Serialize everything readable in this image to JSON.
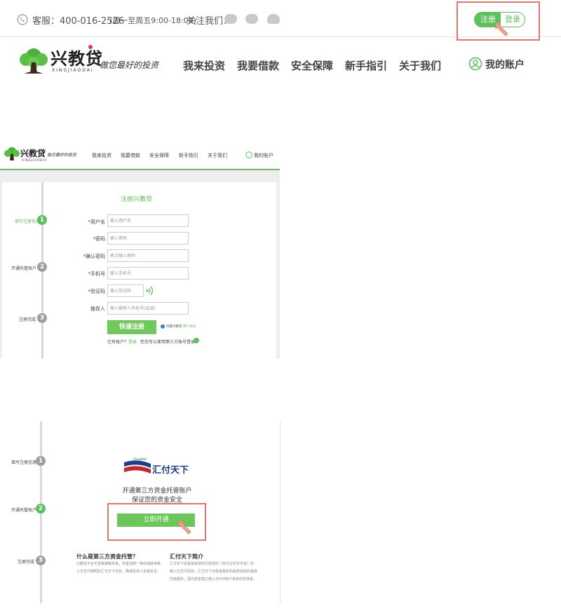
{
  "topbar": {
    "hotline": "客服：400-016-2526",
    "hours": "(周一至周五9:00-18:00)",
    "follow": "关注我们：",
    "social_icons": [
      "wechat-icon",
      "weibo-icon",
      "qq-icon"
    ],
    "register": "注册",
    "login": "登录"
  },
  "header": {
    "logo_cn": "兴教贷",
    "logo_en": "XINGJIAODAI",
    "slogan": "做您最好的投资",
    "nav": [
      "我来投资",
      "我要借款",
      "安全保障",
      "新手指引",
      "关于我们"
    ],
    "account": "我的账户"
  },
  "register_page": {
    "title": "注册兴教贷",
    "steps": [
      {
        "num": "1",
        "label": "填写注册信息"
      },
      {
        "num": "2",
        "label": "开通托管账户"
      },
      {
        "num": "3",
        "label": "注册完成"
      }
    ],
    "fields": [
      {
        "label": "*用户名",
        "placeholder": "输入用户名"
      },
      {
        "label": "*密码",
        "placeholder": "输入密码"
      },
      {
        "label": "*确认密码",
        "placeholder": "再次输入密码"
      },
      {
        "label": "*手机号",
        "placeholder": "输入手机号"
      },
      {
        "label": "*验证码",
        "placeholder": "输入验证码"
      },
      {
        "label": "推荐人",
        "placeholder": "输入推荐人手机号(选填)"
      }
    ],
    "submit": "快速注册",
    "agree_prefix": "同意兴教贷",
    "agree_link": "用户协议",
    "have_account": "已有账户？",
    "login_link": "登录",
    "third_party": "您也可以使用第三方账号登录"
  },
  "custody_page": {
    "brand_small": "ChinaPnR",
    "brand": "汇付天下",
    "headline1": "开通第三方资金托管账户",
    "headline2": "保证您的资金安全",
    "open_button": "立即开通",
    "faq1_title": "什么是第三方资金托管？",
    "faq1_text": [
      "兴教贷平台不直接接触资金，资金流转一律由独获得第",
      "三方支付牌照的汇付天下托管，确保投资人资金安全。"
    ],
    "faq2_title": "汇付天下简介",
    "faq2_text": [
      "汇付天下是首批获得央行颁发的《支付业务许可证》的",
      "第三方支付机构。汇付天下向各金融机构提供高效的金融",
      "托管服务，国内首家建立第三方P2P账户系统托管体系。"
    ]
  },
  "colors": {
    "accent": "#5cc15a",
    "highlight": "#e2766b"
  }
}
